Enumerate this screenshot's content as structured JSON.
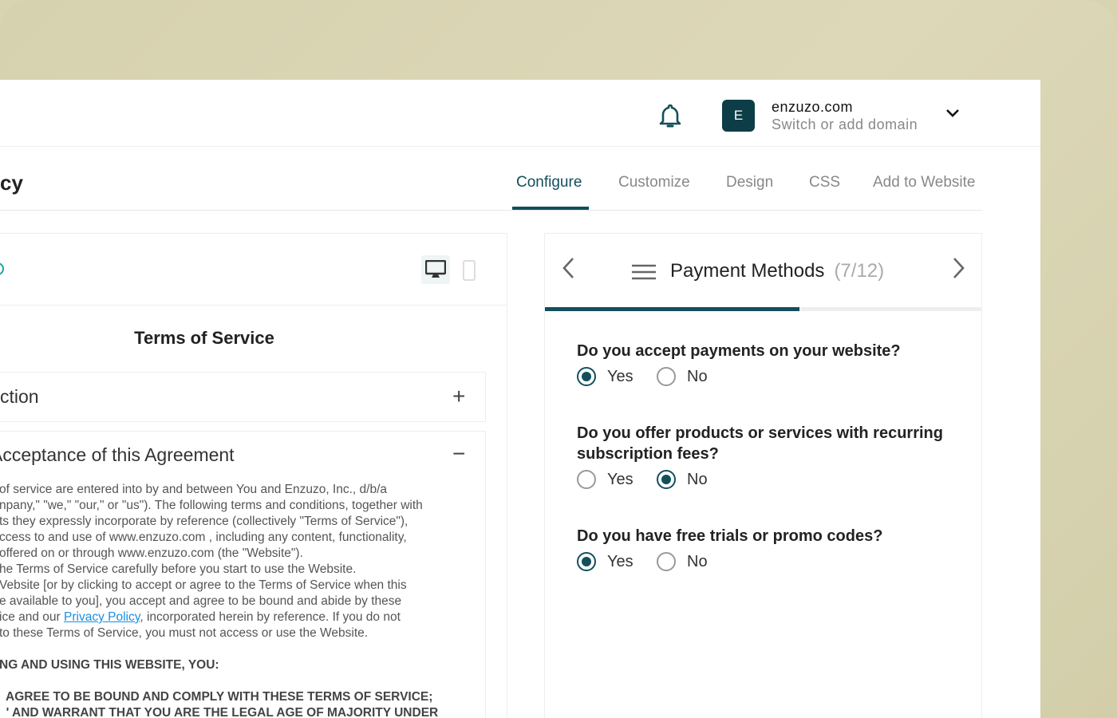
{
  "colors": {
    "accent": "#124f5c",
    "avatar": "#0d3d46",
    "link": "#1a8fe0",
    "background": "#d8d3b0"
  },
  "header": {
    "avatar_letter": "E",
    "domain": "enzuzo.com",
    "domain_sub": "Switch or add domain",
    "icons": [
      "bell-icon",
      "chevron-down-icon"
    ]
  },
  "page": {
    "title": "cy"
  },
  "tabs": [
    {
      "label": "Configure",
      "active": true
    },
    {
      "label": "Customize"
    },
    {
      "label": "Design"
    },
    {
      "label": "CSS"
    },
    {
      "label": "Add to Website"
    }
  ],
  "preview": {
    "heading": "Terms of Service",
    "device_icons": [
      "desktop-icon",
      "mobile-icon"
    ],
    "sections": [
      {
        "title": "ction",
        "expanded": false,
        "sign": "+"
      },
      {
        "title": "Acceptance of this Agreement",
        "expanded": true,
        "sign": "−"
      }
    ],
    "lines": [
      "of service are entered into by and between You and Enzuzo, Inc., d/b/a",
      "npany,\" \"we,\" \"our,\" or \"us\"). The following terms and conditions, together with",
      "ts they expressly incorporate by reference (collectively \"Terms of Service\"),",
      "ccess to and use of www.enzuzo.com , including any content, functionality,",
      "offered on or through www.enzuzo.com (the \"Website\").",
      "he Terms of Service carefully before you start to use the Website.",
      "Vebsite [or by clicking to accept or agree to the Terms of Service when this",
      "e available to you], you accept and agree to be bound and abide by these"
    ],
    "line9_pre": "ice and our ",
    "link": "Privacy Policy",
    "line9_post": ", incorporated herein by reference. If you do not",
    "line10": " to these Terms of Service, you must not access or use the Website.",
    "caps1": "NG AND USING THIS WEBSITE, YOU:",
    "caps2": "  AGREE TO BE BOUND AND COMPLY WITH THESE TERMS OF SERVICE;",
    "caps3": "  ' AND WARRANT THAT YOU ARE THE LEGAL AGE OF MAJORITY UNDER"
  },
  "wizard": {
    "step_title": "Payment Methods",
    "step_count": "(7/12)",
    "progress": 0.583,
    "questions": [
      {
        "text": "Do you accept payments on your website?",
        "options": [
          "Yes",
          "No"
        ],
        "selected": "Yes"
      },
      {
        "text": "Do you offer products or services with recurring subscription fees?",
        "options": [
          "Yes",
          "No"
        ],
        "selected": "No"
      },
      {
        "text": "Do you have free trials or promo codes?",
        "options": [
          "Yes",
          "No"
        ],
        "selected": "Yes"
      }
    ]
  }
}
